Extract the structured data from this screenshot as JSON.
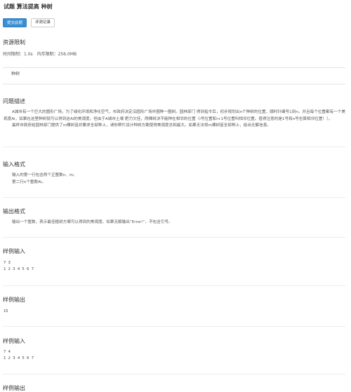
{
  "header": {
    "title": "试题 算法提高 种树",
    "submit_label": "提交此题",
    "record_label": "评测记录"
  },
  "resource": {
    "heading": "资源限制",
    "time_limit": "时间限制：1.0s",
    "memory_limit": "内存限制：256.0MB",
    "tag": "种树"
  },
  "problem": {
    "heading": "问题描述",
    "p1": "A城市有一个巨大的圆形广场，为了绿化环境和净化空气，市政府决定沿圆形广场外圈种一圈树。园林部门 得到指令后，初步规划出n个种树的位置，顺时针编号1到n。并且每个位置都有一个美观度Ai，如果在这里种树就可以得到这Ai的美观度。但由于A城市土壤 肥力欠佳，两棵树决不能种在相邻的位置（i号位置和i+1号位置叫相邻位置。值得注意的是1号和n号也算相邻位置！）。",
    "p2": "最终市政府给园林部门提供了m棵树苗并要求全部种上，请你帮忙设计种树方案使得美观度总和最大。如果无法将m棵树苗全部种上，给出无解信息。"
  },
  "input_format": {
    "heading": "输入格式",
    "line1": "输入的第一行包含两个正整数n、m。",
    "line2": "第二行n个整数Ai。"
  },
  "output_format": {
    "heading": "输出格式",
    "line1": "输出一个整数，表示最佳植树方案可以得到的美观度。如果无解输出“Error!”，不包含引号。"
  },
  "sample_input_1": {
    "heading": "样例输入",
    "line1": "7 3",
    "line2": "1 2 3 4 5 6 7"
  },
  "sample_output_1": {
    "heading": "样例输出",
    "line1": "15"
  },
  "sample_input_2": {
    "heading": "样例输入",
    "line1": "7 4",
    "line2": "1 2 3 4 5 6 7"
  },
  "sample_output_2": {
    "heading": "样例输出"
  }
}
